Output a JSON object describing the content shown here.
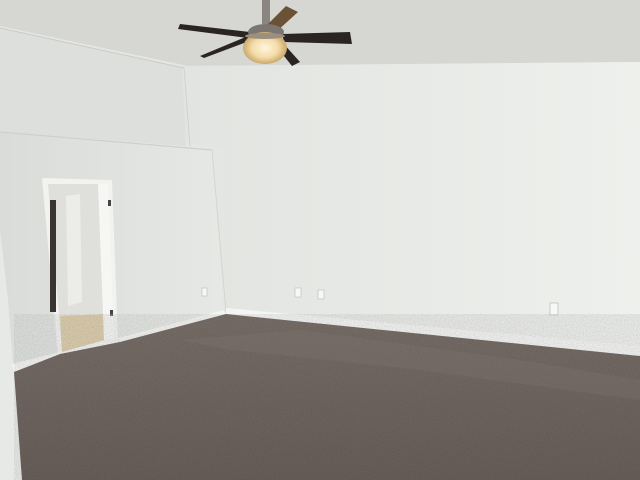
{
  "scene": {
    "subject": "empty-bedroom",
    "objects": [
      "ceiling-fan",
      "light-fixture",
      "doorway",
      "electrical-outlets",
      "baseboard",
      "carpet"
    ]
  },
  "colors": {
    "ceiling": "#d8d9d4",
    "back_wall": "#e9eae7",
    "left_wall": "#e3e5e2",
    "left_upper_wall": "#dddfdb",
    "baseboard": "#f2f3f1",
    "carpet": "#6f6560",
    "carpet_light": "#857a74",
    "door_frame": "#f4f4f2",
    "hall_floor": "#d9c7a3",
    "fan_blade": "#2b2624",
    "fan_blade_wood": "#6b5236",
    "light_glow": "#f3dca8"
  }
}
